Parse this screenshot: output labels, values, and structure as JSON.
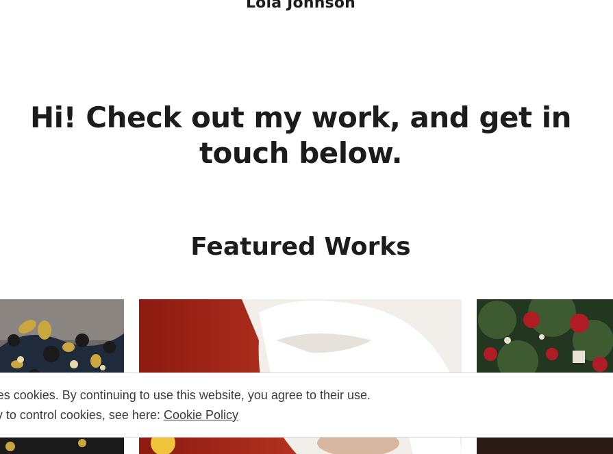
{
  "site": {
    "title": "Lola Johnson"
  },
  "hero": {
    "line1": "Hi! Check out my work, and get in",
    "line2": "touch below."
  },
  "featured": {
    "heading": "Featured Works",
    "items": [
      {
        "subject": "flowers-ornament"
      },
      {
        "subject": "santa-claus-portrait"
      },
      {
        "subject": "christmas-tree-ornaments"
      }
    ]
  },
  "cookie_banner": {
    "line1": "es cookies. By continuing to use this website, you agree to their use.",
    "line2_prefix": "v to control cookies, see here: ",
    "link_label": "Cookie Policy"
  },
  "colors": {
    "text": "#1c1c1c",
    "banner_text": "#3a3a3a",
    "background": "#ffffff"
  }
}
